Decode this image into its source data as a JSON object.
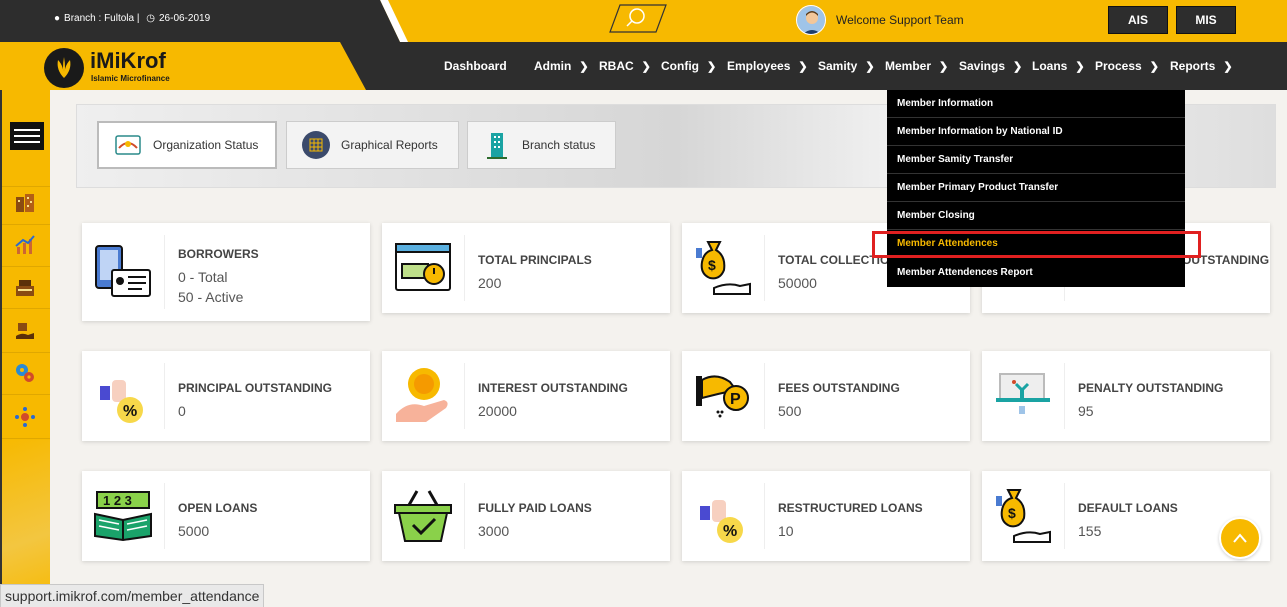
{
  "topbar": {
    "branch_label": "Branch : Fultola |",
    "date": "26-06-2019",
    "welcome": "Welcome Support Team",
    "ais_label": "AIS",
    "mis_label": "MIS"
  },
  "logo": {
    "name": "iMiKrof",
    "tagline": "Islamic Microfinance"
  },
  "nav": {
    "items": [
      {
        "label": "Dashboard",
        "has_menu": false
      },
      {
        "label": "Admin",
        "has_menu": true
      },
      {
        "label": "RBAC",
        "has_menu": true
      },
      {
        "label": "Config",
        "has_menu": true
      },
      {
        "label": "Employees",
        "has_menu": true
      },
      {
        "label": "Samity",
        "has_menu": true
      },
      {
        "label": "Member",
        "has_menu": true
      },
      {
        "label": "Savings",
        "has_menu": true
      },
      {
        "label": "Loans",
        "has_menu": true
      },
      {
        "label": "Process",
        "has_menu": true
      },
      {
        "label": "Reports",
        "has_menu": true
      }
    ]
  },
  "member_menu": {
    "items": [
      "Member Information",
      "Member Information by National ID",
      "Member Samity Transfer",
      "Member Primary Product Transfer",
      "Member Closing",
      "Member Attendences",
      "Member Attendences Report"
    ],
    "active_index": 5
  },
  "tabs": [
    {
      "label": "Organization Status",
      "icon": "handshake-icon",
      "active": true
    },
    {
      "label": "Graphical Reports",
      "icon": "chart-grid-icon",
      "active": false
    },
    {
      "label": "Branch status",
      "icon": "building-icon",
      "active": false
    }
  ],
  "cards": [
    {
      "title": "BORROWERS",
      "lines": [
        "0 - Total",
        "50 - Active"
      ],
      "icon": "id-card-phone-icon"
    },
    {
      "title": "TOTAL PRINCIPALS",
      "lines": [
        "200"
      ],
      "icon": "cash-timer-icon"
    },
    {
      "title": "TOTAL COLLECTION",
      "lines": [
        "50000"
      ],
      "icon": "money-bag-hand-icon"
    },
    {
      "title": "OUTSTANDING",
      "lines": [
        ""
      ],
      "icon": "money-icon"
    },
    {
      "title": "PRINCIPAL OUTSTANDING",
      "lines": [
        "0"
      ],
      "icon": "percent-bag-icon"
    },
    {
      "title": "INTEREST OUTSTANDING",
      "lines": [
        "20000"
      ],
      "icon": "coin-hand-icon"
    },
    {
      "title": "FEES OUTSTANDING",
      "lines": [
        "500"
      ],
      "icon": "hand-coin-p-icon"
    },
    {
      "title": "PENALTY OUTSTANDING",
      "lines": [
        "95"
      ],
      "icon": "penalty-icon"
    },
    {
      "title": "OPEN LOANS",
      "lines": [
        "5000"
      ],
      "icon": "open-book-123-icon"
    },
    {
      "title": "FULLY PAID LOANS",
      "lines": [
        "3000"
      ],
      "icon": "basket-check-icon"
    },
    {
      "title": "RESTRUCTURED LOANS",
      "lines": [
        "10"
      ],
      "icon": "percent-bag-icon"
    },
    {
      "title": "DEFAULT LOANS",
      "lines": [
        "155"
      ],
      "icon": "money-bag-hand-icon"
    }
  ],
  "status_bar": {
    "url": "support.imikrof.com/member_attendance"
  },
  "colors": {
    "brand_yellow": "#f7b900",
    "dark": "#2d2d2d",
    "highlight_red": "#e02020"
  }
}
